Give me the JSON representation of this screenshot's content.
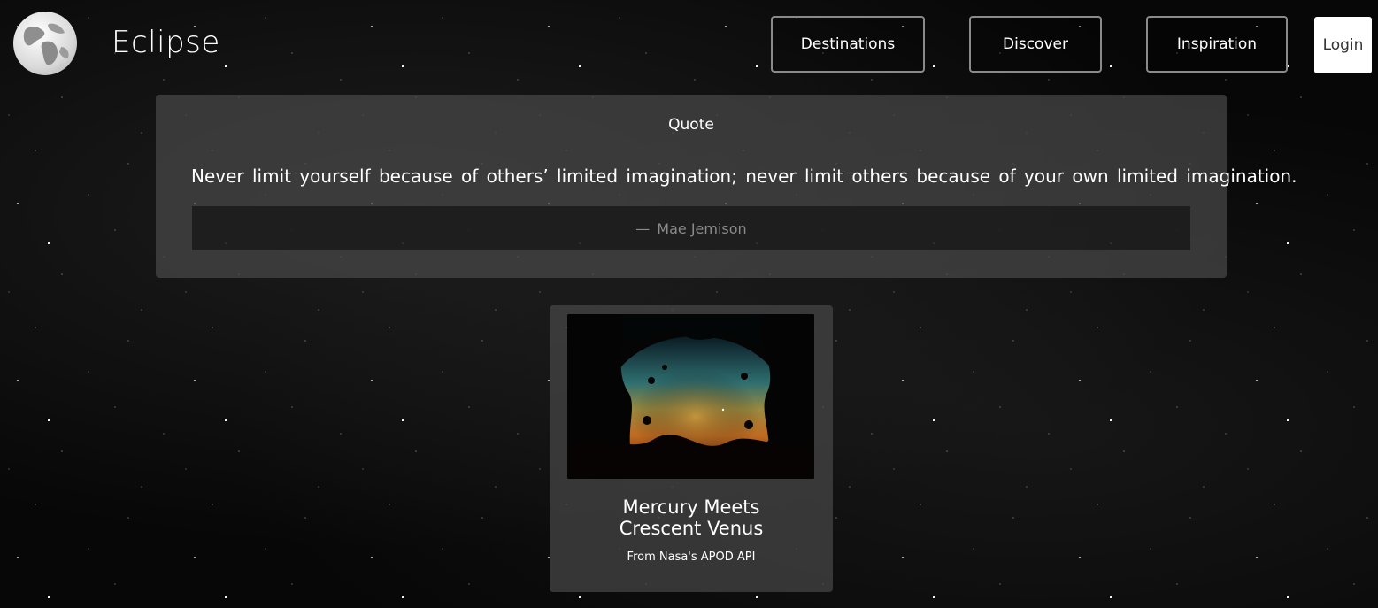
{
  "header": {
    "brand": "Eclipse",
    "nav": [
      {
        "label": "Destinations"
      },
      {
        "label": "Discover"
      },
      {
        "label": "Inspiration"
      }
    ],
    "login_label": "Login"
  },
  "quote": {
    "title": "Quote",
    "text": "Never limit yourself because of others’ limited imagination; never limit others because of your own limited imagination.",
    "dash": "—",
    "author": "Mae Jemison"
  },
  "apod_card": {
    "title_line1": "Mercury Meets",
    "title_line2": "Crescent Venus",
    "caption": "From Nasa's APOD API"
  }
}
